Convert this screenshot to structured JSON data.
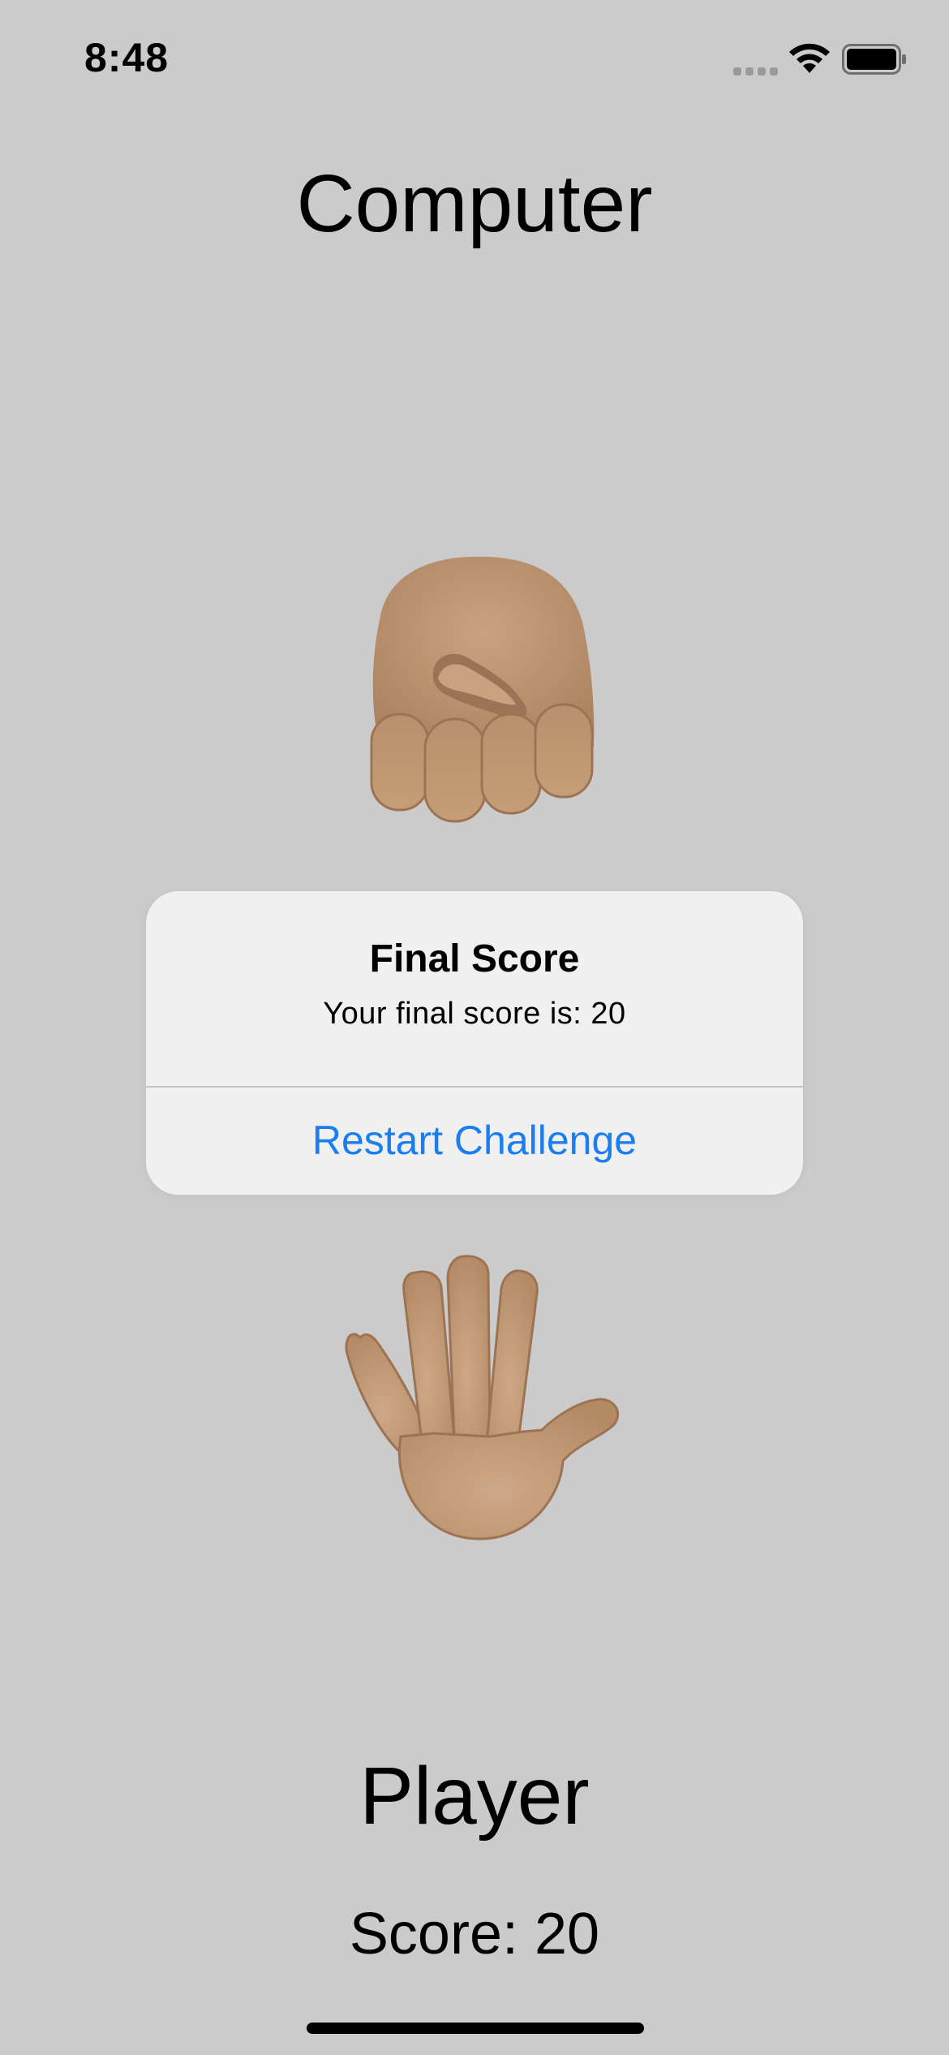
{
  "status_bar": {
    "time": "8:48",
    "signal_icon": "cellular-signal-icon",
    "wifi_icon": "wifi-icon",
    "battery_icon": "battery-icon"
  },
  "computer": {
    "title": "Computer",
    "hand_icon": "raised-fist-icon"
  },
  "player": {
    "title": "Player",
    "hand_icon": "raised-hand-icon",
    "score_label": "Score: 20"
  },
  "alert": {
    "title": "Final Score",
    "message": "Your final score is: 20",
    "button_label": "Restart Challenge"
  },
  "colors": {
    "background": "#cbcbcb",
    "alert_background": "#f0f0f0",
    "accent": "#1a7ef0",
    "skin": "#c79e78"
  }
}
